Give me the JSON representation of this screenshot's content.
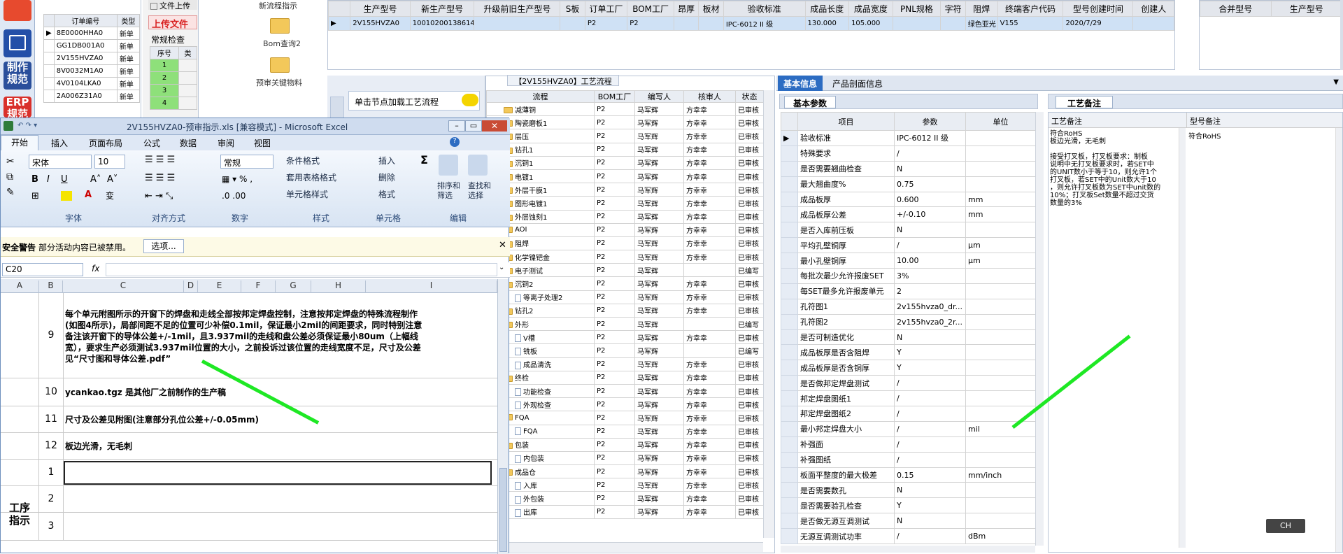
{
  "left_strip": {
    "buttons": [
      {
        "label": "制作\n规范",
        "color": "#2a4f9b"
      },
      {
        "label": "ERP\n规范",
        "color": "#d9302b"
      }
    ]
  },
  "order_table": {
    "headers": [
      "订单编号",
      "类型"
    ],
    "rows": [
      [
        "8E0000HHA0",
        "新单"
      ],
      [
        "GG1DB001A0",
        "新单"
      ],
      [
        "2V155HVZA0",
        "新单"
      ],
      [
        "8V0032M1A0",
        "新单"
      ],
      [
        "4V0104LKA0",
        "新单"
      ],
      [
        "2A006Z31A0",
        "新单"
      ]
    ],
    "selected_index": 0
  },
  "upload_panel": {
    "file_upload": "文件上传",
    "upload_title": "上传文件",
    "section": "常规检查",
    "headers": [
      "序号",
      "类"
    ],
    "rows": [
      "1",
      "2",
      "3",
      "4"
    ]
  },
  "shortcuts": [
    {
      "label": "新流程指示"
    },
    {
      "label": "Bom查询2"
    },
    {
      "label": "预审关键物料"
    }
  ],
  "top_grid": {
    "headers": [
      "生产型号",
      "新生产型号",
      "升级前旧生产型号",
      "S板",
      "订单工厂",
      "BOM工厂",
      "昂厚",
      "板材",
      "验收标准",
      "成品长度",
      "成品宽度",
      "PNL规格",
      "字符",
      "阻焊",
      "终端客户代码",
      "型号创建时间",
      "创建人"
    ],
    "row": [
      "2V155HVZA0",
      "10010200138614",
      "",
      "",
      "P2",
      "P2",
      "",
      "",
      "IPC-6012 II 级",
      "130.000",
      "105.000",
      "",
      "",
      "绿色亚光",
      "V155",
      "2020/7/29",
      ""
    ]
  },
  "merge_grid": {
    "headers": [
      "合并型号",
      "生产型号"
    ]
  },
  "process": {
    "title": "【2V155HVZA0】工艺流程",
    "load_button": "单击节点加载工艺流程",
    "headers": [
      "流程",
      "BOM工厂",
      "编写人",
      "核审人",
      "状态"
    ],
    "rows": [
      {
        "name": "减薄铜",
        "kind": "folder",
        "bom": "P2",
        "writer": "马军辉",
        "reviewer": "方幸幸",
        "status": "已审核"
      },
      {
        "name": "陶瓷磨板1",
        "kind": "folder",
        "bom": "P2",
        "writer": "马军辉",
        "reviewer": "方幸幸",
        "status": "已审核"
      },
      {
        "name": "层压",
        "kind": "folder",
        "bom": "P2",
        "writer": "马军辉",
        "reviewer": "方幸幸",
        "status": "已审核"
      },
      {
        "name": "钻孔1",
        "kind": "folder",
        "bom": "P2",
        "writer": "马军辉",
        "reviewer": "方幸幸",
        "status": "已审核"
      },
      {
        "name": "沉铜1",
        "kind": "folder",
        "bom": "P2",
        "writer": "马军辉",
        "reviewer": "方幸幸",
        "status": "已审核"
      },
      {
        "name": "电镀1",
        "kind": "folder",
        "bom": "P2",
        "writer": "马军辉",
        "reviewer": "方幸幸",
        "status": "已审核"
      },
      {
        "name": "外层干膜1",
        "kind": "folder",
        "bom": "P2",
        "writer": "马军辉",
        "reviewer": "方幸幸",
        "status": "已审核"
      },
      {
        "name": "图形电镀1",
        "kind": "folder",
        "bom": "P2",
        "writer": "马军辉",
        "reviewer": "方幸幸",
        "status": "已审核"
      },
      {
        "name": "外层蚀刻1",
        "kind": "folder",
        "bom": "P2",
        "writer": "马军辉",
        "reviewer": "方幸幸",
        "status": "已审核"
      },
      {
        "name": "AOI",
        "kind": "folder",
        "bom": "P2",
        "writer": "马军辉",
        "reviewer": "方幸幸",
        "status": "已审核"
      },
      {
        "name": "阻焊",
        "kind": "folder",
        "bom": "P2",
        "writer": "马军辉",
        "reviewer": "方幸幸",
        "status": "已审核"
      },
      {
        "name": "化学镍钯金",
        "kind": "folder",
        "bom": "P2",
        "writer": "马军辉",
        "reviewer": "方幸幸",
        "status": "已审核"
      },
      {
        "name": "电子测试",
        "kind": "folder",
        "bom": "P2",
        "writer": "马军辉",
        "reviewer": "",
        "status": "已编写"
      },
      {
        "name": "沉铜2",
        "kind": "folder",
        "bom": "P2",
        "writer": "马军辉",
        "reviewer": "方幸幸",
        "status": "已审核"
      },
      {
        "name": "等离子处理2",
        "kind": "doc",
        "bom": "P2",
        "writer": "马军辉",
        "reviewer": "方幸幸",
        "status": "已审核"
      },
      {
        "name": "钻孔2",
        "kind": "folder",
        "bom": "P2",
        "writer": "马军辉",
        "reviewer": "方幸幸",
        "status": "已审核"
      },
      {
        "name": "外形",
        "kind": "folder",
        "bom": "P2",
        "writer": "马军辉",
        "reviewer": "",
        "status": "已编写"
      },
      {
        "name": "V槽",
        "kind": "doc",
        "bom": "P2",
        "writer": "马军辉",
        "reviewer": "方幸幸",
        "status": "已审核"
      },
      {
        "name": "铣板",
        "kind": "doc",
        "bom": "P2",
        "writer": "马军辉",
        "reviewer": "",
        "status": "已编写"
      },
      {
        "name": "成品清洗",
        "kind": "doc",
        "bom": "P2",
        "writer": "马军辉",
        "reviewer": "方幸幸",
        "status": "已审核"
      },
      {
        "name": "终检",
        "kind": "folder",
        "bom": "P2",
        "writer": "马军辉",
        "reviewer": "方幸幸",
        "status": "已审核"
      },
      {
        "name": "功能检查",
        "kind": "doc",
        "bom": "P2",
        "writer": "马军辉",
        "reviewer": "方幸幸",
        "status": "已审核"
      },
      {
        "name": "外观检查",
        "kind": "doc",
        "bom": "P2",
        "writer": "马军辉",
        "reviewer": "方幸幸",
        "status": "已审核"
      },
      {
        "name": "FQA",
        "kind": "folder",
        "bom": "P2",
        "writer": "马军辉",
        "reviewer": "方幸幸",
        "status": "已审核"
      },
      {
        "name": "FQA",
        "kind": "doc",
        "bom": "P2",
        "writer": "马军辉",
        "reviewer": "方幸幸",
        "status": "已审核"
      },
      {
        "name": "包装",
        "kind": "folder",
        "bom": "P2",
        "writer": "马军辉",
        "reviewer": "方幸幸",
        "status": "已审核"
      },
      {
        "name": "内包装",
        "kind": "doc",
        "bom": "P2",
        "writer": "马军辉",
        "reviewer": "方幸幸",
        "status": "已审核"
      },
      {
        "name": "成品仓",
        "kind": "folder",
        "bom": "P2",
        "writer": "马军辉",
        "reviewer": "方幸幸",
        "status": "已审核"
      },
      {
        "name": "入库",
        "kind": "doc",
        "bom": "P2",
        "writer": "马军辉",
        "reviewer": "方幸幸",
        "status": "已审核"
      },
      {
        "name": "外包装",
        "kind": "doc",
        "bom": "P2",
        "writer": "马军辉",
        "reviewer": "方幸幸",
        "status": "已审核"
      },
      {
        "name": "出库",
        "kind": "doc",
        "bom": "P2",
        "writer": "马军辉",
        "reviewer": "方幸幸",
        "status": "已审核"
      }
    ]
  },
  "info": {
    "tabs": [
      "基本信息",
      "产品剖面信息"
    ],
    "subtab": "基本参数",
    "headers": [
      "项目",
      "参数",
      "单位"
    ],
    "rows": [
      [
        "验收标准",
        "IPC-6012 II 级",
        ""
      ],
      [
        "特殊要求",
        "/",
        ""
      ],
      [
        "是否需要翘曲检查",
        "N",
        ""
      ],
      [
        "最大翘曲度%",
        "0.75",
        ""
      ],
      [
        "成品板厚",
        "0.600",
        "mm"
      ],
      [
        "成品板厚公差",
        "+/-0.10",
        "mm"
      ],
      [
        "是否入库前压板",
        "N",
        ""
      ],
      [
        "平均孔壁铜厚",
        "/",
        "μm"
      ],
      [
        "最小孔壁铜厚",
        "10.00",
        "μm"
      ],
      [
        "每批次最少允许报废SET",
        "3%",
        ""
      ],
      [
        "每SET最多允许报废单元",
        "2",
        ""
      ],
      [
        "孔符图1",
        "2v155hvza0_dr...",
        ""
      ],
      [
        "孔符图2",
        "2v155hvza0_2r...",
        ""
      ],
      [
        "是否可制造优化",
        "N",
        ""
      ],
      [
        "成品板厚是否含阻焊",
        "Y",
        ""
      ],
      [
        "成品板厚是否含铜厚",
        "Y",
        ""
      ],
      [
        "是否做邦定焊盘测试",
        "/",
        ""
      ],
      [
        "邦定焊盘图纸1",
        "/",
        ""
      ],
      [
        "邦定焊盘图纸2",
        "/",
        ""
      ],
      [
        "最小邦定焊盘大小",
        "/",
        "mil"
      ],
      [
        "补强面",
        "/",
        ""
      ],
      [
        "补强图纸",
        "/",
        ""
      ],
      [
        "板面平整度的最大极差",
        "0.15",
        "mm/inch"
      ],
      [
        "是否需要数孔",
        "N",
        ""
      ],
      [
        "是否需要验孔检查",
        "Y",
        ""
      ],
      [
        "是否做无源互调测试",
        "N",
        ""
      ],
      [
        "无源互调测试功率",
        "/",
        "dBm"
      ]
    ]
  },
  "remarks": {
    "tab": "工艺备注",
    "headers": [
      "工艺备注",
      "型号备注"
    ],
    "process_note": "符合RoHS\n板边光滑，无毛刺\n\n接受打叉板，打叉板要求：制板\n说明中无打叉板要求时，若SET中\n的UNIT数小于等于10，则允许1个\n打叉板，若SET中的Unit数大于10\n，则允许打叉板数为SET中unit数的\n10%；打叉板Set数量不超过交货\n数量的3%",
    "model_note": "符合RoHS"
  },
  "ime": "CH",
  "excel": {
    "title": "2V155HVZA0-预审指示.xls [兼容模式] - Microsoft Excel",
    "tabs": [
      "开始",
      "插入",
      "页面布局",
      "公式",
      "数据",
      "审阅",
      "视图"
    ],
    "font_name": "宋体",
    "font_size": "10",
    "number_format": "常规",
    "groups": [
      "字体",
      "对齐方式",
      "数字",
      "样式",
      "单元格",
      "编辑"
    ],
    "style_items": [
      "条件格式",
      "套用表格格式",
      "单元格样式"
    ],
    "cell_items": [
      "插入",
      "删除",
      "格式"
    ],
    "edit_items": [
      "排序和\n筛选",
      "查找和\n选择"
    ],
    "security_title": "安全警告",
    "security_msg": "部分活动内容已被禁用。",
    "options_btn": "选项...",
    "name_box": "C20",
    "fx": "fx",
    "columns": [
      "A",
      "B",
      "C",
      "D",
      "E",
      "F",
      "G",
      "H",
      "I"
    ],
    "rows": [
      {
        "num": "9",
        "text": "每个单元附图所示的开窗下的焊盘和走线全部按邦定焊盘控制，注意按邦定焊盘的特殊流程制作\n(如图4所示)，局部间距不足的位置可少补偿0.1mil，保证最小2mil的间距要求，同时特别注意\n备注该开窗下的导体公差+/-1mil，且3.937mil的走线和盘公差必须保证最小80um（上幅线\n宽），要求生产必须测试3.937mil位置的大小，之前投诉过该位置的走线宽度不足，尺寸及公差\n见“尺寸图和导体公差.pdf”"
      },
      {
        "num": "10",
        "text": "ycankao.tgz 是其他厂之前制作的生产稿"
      },
      {
        "num": "11",
        "text": "尺寸及公差见附图(注意部分孔位公差+/-0.05mm)"
      },
      {
        "num": "12",
        "text": "板边光滑，无毛刺"
      },
      {
        "num": "1",
        "text": ""
      },
      {
        "num": "2",
        "text": ""
      },
      {
        "num": "3",
        "text": ""
      }
    ],
    "section_label": "工序\n指示"
  }
}
